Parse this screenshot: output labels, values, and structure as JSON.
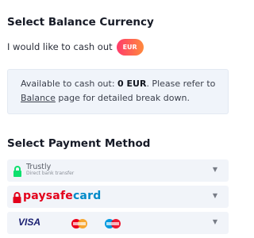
{
  "balance": {
    "title": "Select Balance Currency",
    "cashout_label": "I would like to cash out",
    "currency": "EUR"
  },
  "info": {
    "line1_prefix": "Available to cash out: ",
    "amount": "0 EUR",
    "line1_suffix": ". Please refer to",
    "link": "Balance",
    "line2_suffix": " page for detailed break down."
  },
  "payment": {
    "title": "Select Payment Method",
    "methods": [
      {
        "name": "Trustly",
        "subtitle": "Direct bank transfer",
        "icon": "lock-icon"
      },
      {
        "name": "paysafecard",
        "name_part1": "paysafe",
        "name_part2": "card",
        "icon": "lock-icon"
      },
      {
        "name": "VISA",
        "icons": [
          "mastercard-icon",
          "maestro-icon"
        ]
      }
    ]
  },
  "colors": {
    "pill_start": "#ff3b6b",
    "pill_end": "#ff8a3d",
    "trustly_green": "#0ee06e",
    "paysafe_red": "#e3001b",
    "paysafe_blue": "#008ac9",
    "visa_blue": "#1a1f71"
  }
}
